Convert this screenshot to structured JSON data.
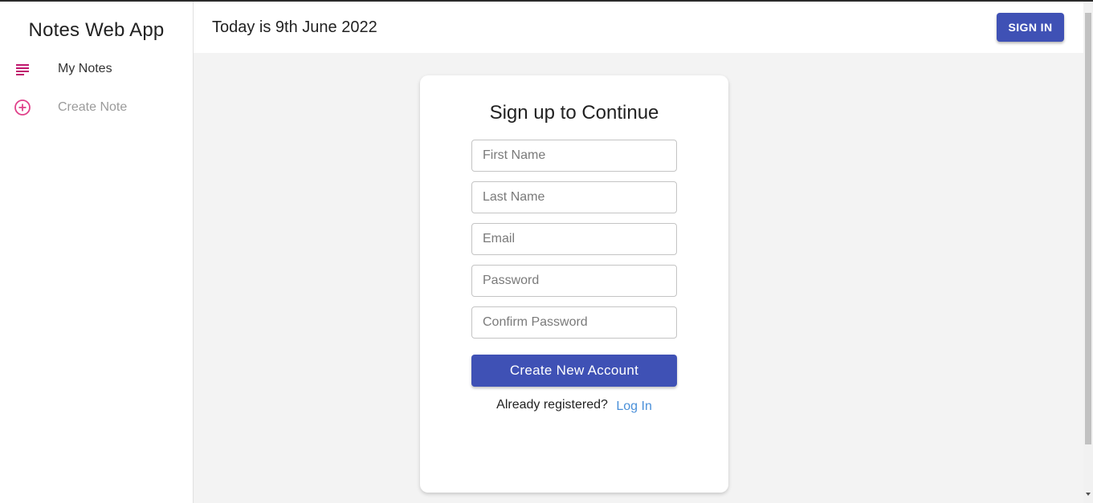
{
  "sidebar": {
    "app_title": "Notes Web App",
    "items": [
      {
        "label": "My Notes",
        "icon": "notes-list-icon"
      },
      {
        "label": "Create Note",
        "icon": "add-circle-icon"
      }
    ]
  },
  "header": {
    "date_text": "Today is 9th June 2022",
    "signin_label": "SIGN IN"
  },
  "form": {
    "title": "Sign up to Continue",
    "first_name_placeholder": "First Name",
    "last_name_placeholder": "Last Name",
    "email_placeholder": "Email",
    "password_placeholder": "Password",
    "confirm_password_placeholder": "Confirm Password",
    "submit_label": "Create New Account",
    "already_text": "Already registered?",
    "login_link": "Log In"
  },
  "colors": {
    "primary": "#3f51b5",
    "accent_pink": "#e0408a",
    "link": "#4a90d9"
  }
}
